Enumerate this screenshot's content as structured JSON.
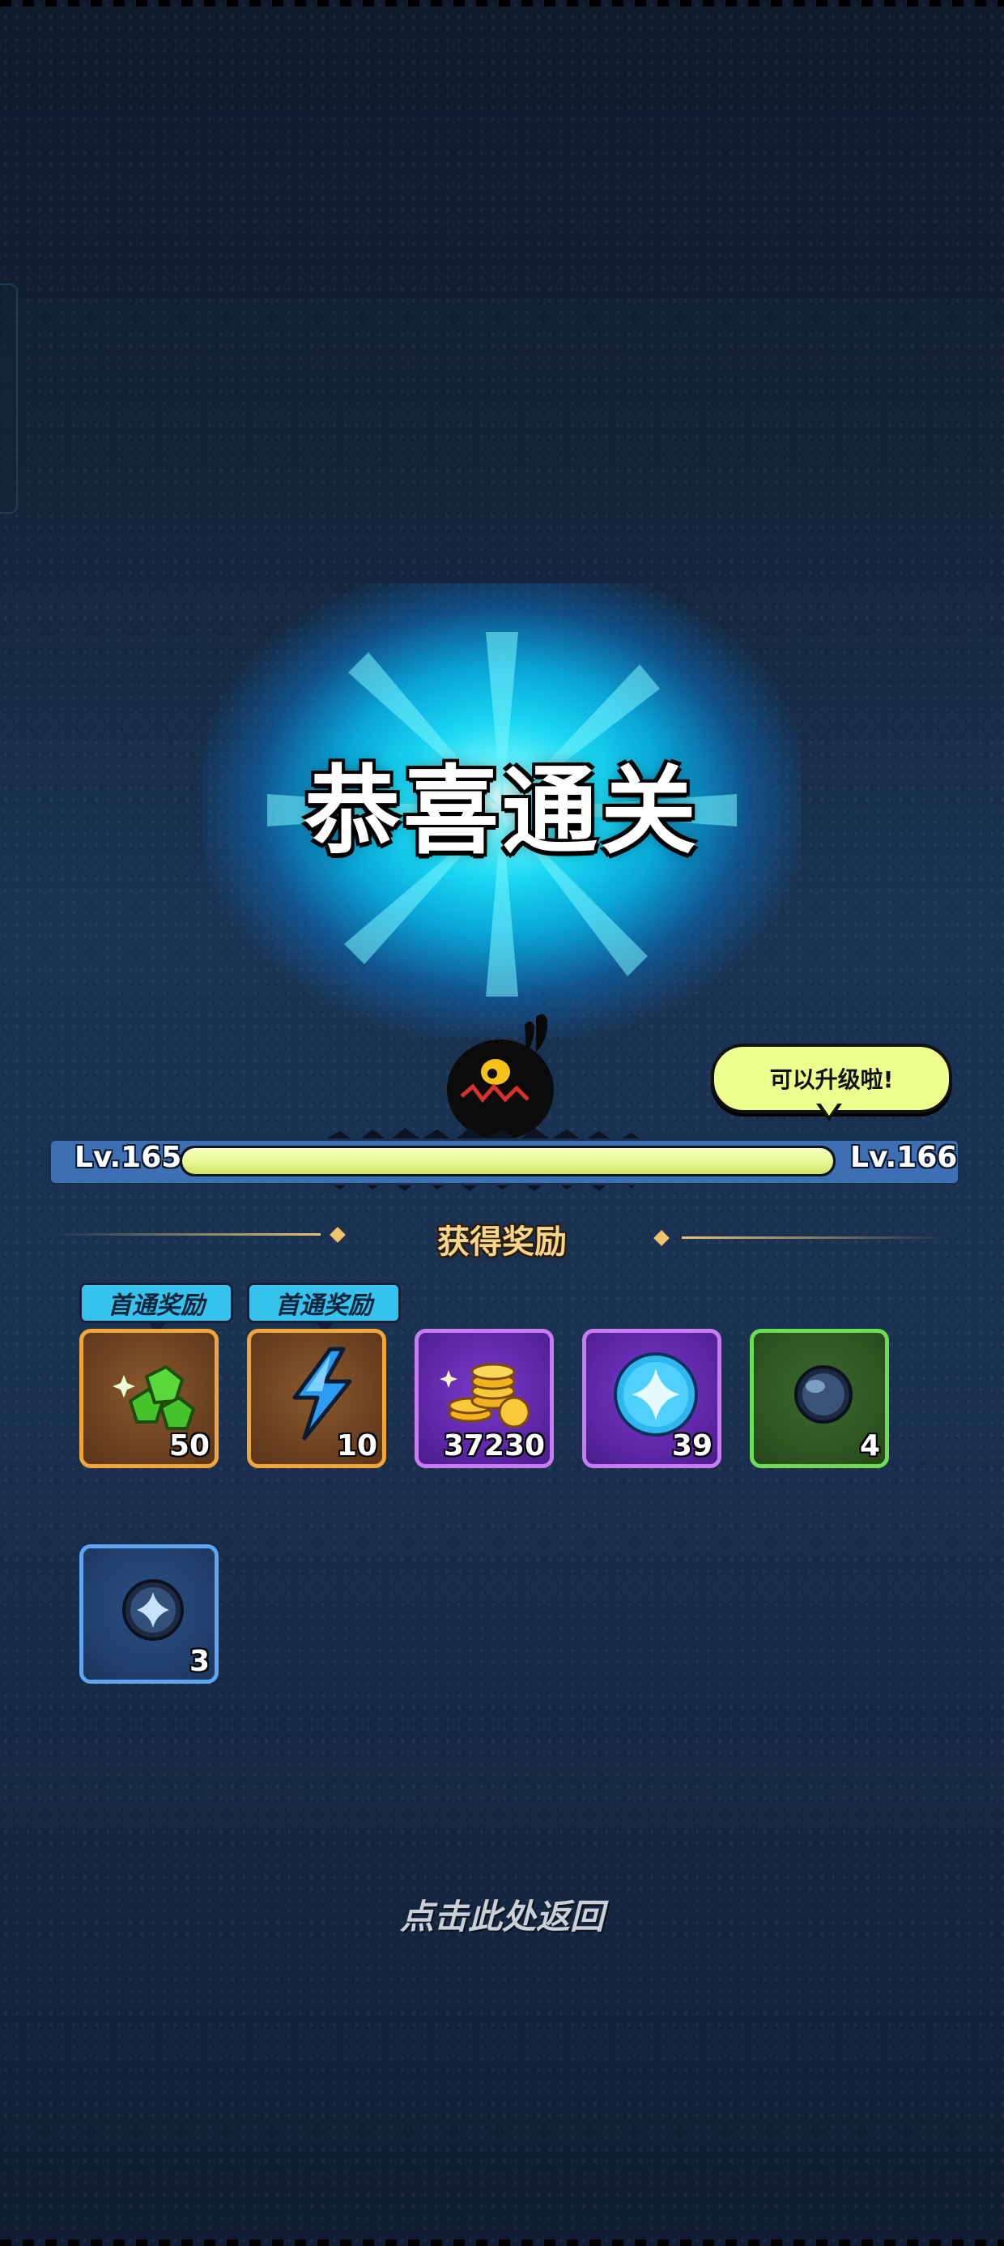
{
  "title": "恭喜通关",
  "speech_bubble": "可以升级啦!",
  "level": {
    "current": "Lv.165",
    "next": "Lv.166",
    "progress": 1.0
  },
  "rewards_header": "获得奖励",
  "first_clear_badge": "首通奖励",
  "rewards": [
    {
      "icon": "green-gem-icon",
      "quantity": "50",
      "rarity": "bronze",
      "first_clear": true
    },
    {
      "icon": "lightning-energy-icon",
      "quantity": "10",
      "rarity": "bronze",
      "first_clear": true
    },
    {
      "icon": "gold-coins-icon",
      "quantity": "37230",
      "rarity": "purple",
      "first_clear": false
    },
    {
      "icon": "blue-star-orb-icon",
      "quantity": "39",
      "rarity": "purple",
      "first_clear": false
    },
    {
      "icon": "dark-orb-icon",
      "quantity": "4",
      "rarity": "green",
      "first_clear": false
    },
    {
      "icon": "star-orb-icon",
      "quantity": "3",
      "rarity": "blue",
      "first_clear": false
    }
  ],
  "return_prompt": "点击此处返回",
  "colors": {
    "glow": "#19d6f2",
    "xp_fill": "#e6f78f",
    "bubble": "#eeff8e",
    "badge": "#35c3ee",
    "header_gold": "#f6d68a"
  }
}
